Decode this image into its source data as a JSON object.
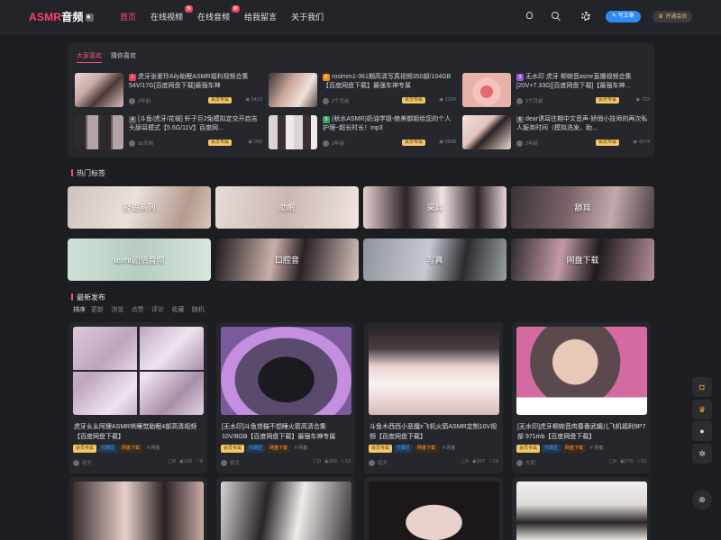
{
  "header": {
    "logo_accent": "ASMR",
    "logo_rest": "音频",
    "nav": [
      {
        "label": "首页",
        "badge": ""
      },
      {
        "label": "在线视频",
        "badge": "热"
      },
      {
        "label": "在线音频",
        "badge": "新"
      },
      {
        "label": "给我留言",
        "badge": ""
      },
      {
        "label": "关于我们",
        "badge": ""
      }
    ],
    "write_label": "写文章",
    "vip_label": "开通会员"
  },
  "featured": {
    "tabs": [
      "大家喜欢",
      "猜你喜欢"
    ],
    "items": [
      {
        "rank": "1",
        "title": "虎牙张爱玲Aily助眠ASMR福利视频合集54V/17G[百度网盘下载]最强车神",
        "time": "2年前",
        "badge": "会员专属",
        "views": "5413"
      },
      {
        "rank": "2",
        "title": "rosimm1-361期高清写真视频350部/104GB【百度网盘下载】最强车神专属",
        "time": "2个月前",
        "badge": "会员专属",
        "views": "1200"
      },
      {
        "rank": "3",
        "title": "无水印 虎牙 柳婉音asmr直播视频合集[20V+7.33G][百度网盘下载]【最强车神...",
        "time": "2个月前",
        "badge": "会员专属",
        "views": "722"
      },
      {
        "rank": "4",
        "title": "[斗鱼/虎牙/花椒] 轩子巨2兔模拟定交开启吉头舔耳模式【5.6G/11V】百度网...",
        "time": "56天前",
        "badge": "会员专属",
        "views": "959"
      },
      {
        "rank": "5",
        "title": "(秋水ASMR)奶油学姐-绝美御姐给您的个人护理~超长时长！mp3",
        "time": "2年前",
        "badge": "会员专属",
        "views": "6838"
      },
      {
        "rank": "6",
        "title": "dear诱耳往期中文音声-娇俏小技师的再次私人服务时间（模拟洗发、助...",
        "time": "2年前",
        "badge": "会员专属",
        "views": "4074"
      }
    ]
  },
  "hot_tags": {
    "title": "热门标签",
    "tags": [
      "轻语系列",
      "助眠",
      "采耳",
      "舔耳",
      "asmr剧情音频",
      "口腔音",
      "写真",
      "网盘下载"
    ]
  },
  "latest": {
    "title": "最新发布",
    "sort_label": "排序",
    "sort_options": [
      "更新",
      "浏览",
      "点赞",
      "评论",
      "收藏",
      "随机"
    ],
    "cards": [
      {
        "title": "虎牙幺幺阿狸ASMR哄睡觉助眠4部高清视频【百度网盘下载】",
        "tags": [
          "会员专属",
          "付费区",
          "网盘下载",
          "# 网盘"
        ],
        "author": "初大",
        "comments": "0",
        "views": "130",
        "likes": "6"
      },
      {
        "title": "[无水印]斗鱼馋猫不想睡火箭高清合集10V/8GB【百度网盘下载】最强车神专属",
        "tags": [
          "会员专属",
          "付费区",
          "网盘下载",
          "# 网盘"
        ],
        "author": "初大",
        "comments": "0",
        "views": "259",
        "likes": "13"
      },
      {
        "title": "斗鱼木西西小恶魔x飞机火箭ASMR定制10V视频【百度网盘下载】",
        "tags": [
          "会员专属",
          "付费区",
          "网盘下载",
          "# 网盘"
        ],
        "author": "初大",
        "comments": "0",
        "views": "197",
        "likes": "13"
      },
      {
        "title": "[无水印]虎牙柳婉音肉春番武媚儿飞机福利9P7部 971mb【百度网盘下载】",
        "tags": [
          "会员专属",
          "付费区",
          "网盘下载",
          "# 网盘"
        ],
        "author": "大初",
        "comments": "0",
        "views": "279",
        "likes": "12"
      }
    ]
  },
  "colors": {
    "accent": "#ff4d73",
    "bg": "#1d1e22",
    "panel": "#26272c",
    "blue": "#2f8af2",
    "gold": "#f3c86a"
  },
  "side_icons": [
    "bag-icon",
    "crown-icon",
    "qq-icon",
    "gear-icon",
    "plus-circle-icon"
  ]
}
